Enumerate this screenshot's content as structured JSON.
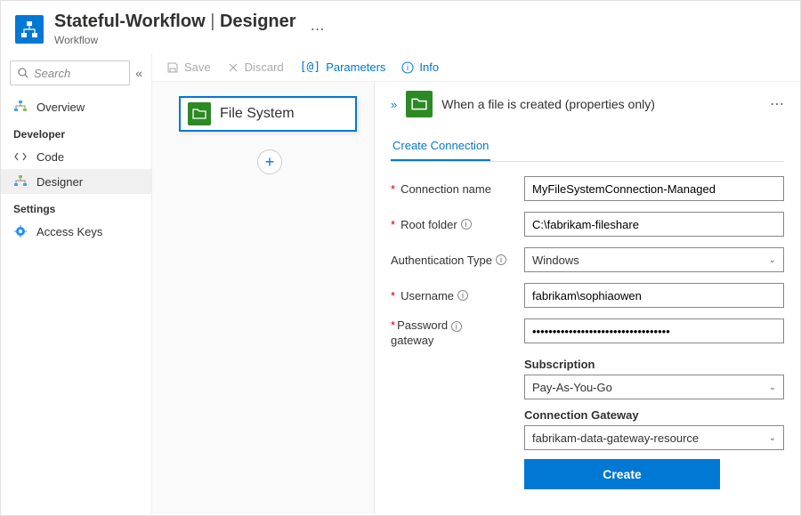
{
  "header": {
    "title_main": "Stateful-Workflow",
    "title_suffix": "Designer",
    "subtitle": "Workflow"
  },
  "sidebar": {
    "search_placeholder": "Search",
    "items": {
      "overview": "Overview",
      "code": "Code",
      "designer": "Designer",
      "access_keys": "Access Keys"
    },
    "sections": {
      "developer": "Developer",
      "settings": "Settings"
    }
  },
  "toolbar": {
    "save": "Save",
    "discard": "Discard",
    "parameters": "Parameters",
    "info": "Info"
  },
  "workflow": {
    "node_label": "File System"
  },
  "panel": {
    "title": "When a file is created (properties only)",
    "tab": "Create Connection",
    "labels": {
      "connection_name": "Connection name",
      "root_folder": "Root folder",
      "auth_type": "Authentication Type",
      "username": "Username",
      "password": "Password",
      "gateway": "gateway",
      "subscription": "Subscription",
      "connection_gateway": "Connection Gateway"
    },
    "values": {
      "connection_name": "MyFileSystemConnection-Managed",
      "root_folder": "C:\\fabrikam-fileshare",
      "auth_type": "Windows",
      "username": "fabrikam\\sophiaowen",
      "password": "••••••••••••••••••••••••••••••••••",
      "subscription": "Pay-As-You-Go",
      "connection_gateway": "fabrikam-data-gateway-resource"
    },
    "create_button": "Create"
  }
}
